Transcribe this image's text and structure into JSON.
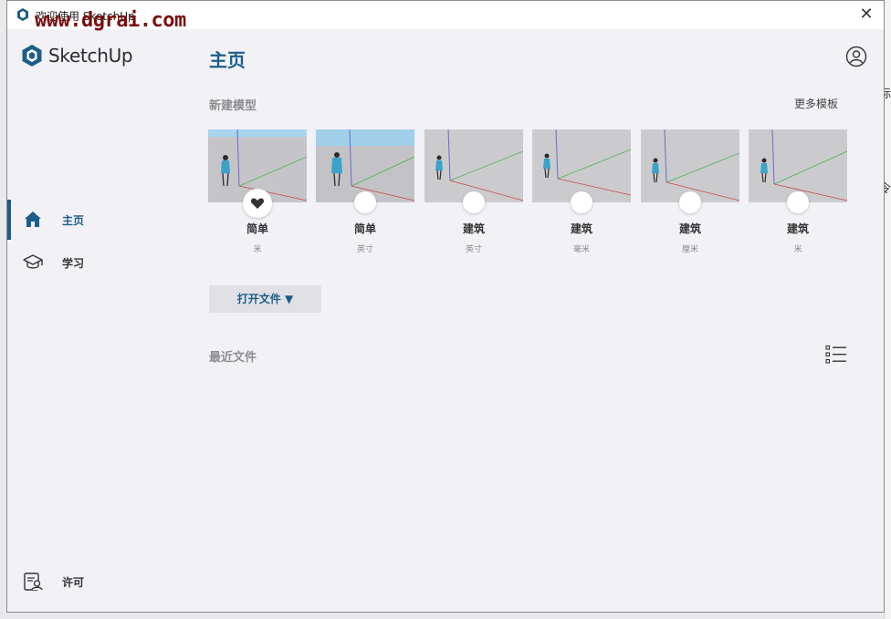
{
  "window": {
    "title": "欢迎使用 SketchUp",
    "watermark": "www.dgrai.com",
    "close_glyph": "✕"
  },
  "background": {
    "side_char_1": "标",
    "side_char_2": "令"
  },
  "brand": {
    "name": "SketchUp",
    "color": "#1c5e88"
  },
  "sidebar": {
    "items": [
      {
        "label": "主页",
        "icon": "home-icon",
        "active": true
      },
      {
        "label": "学习",
        "icon": "graduation-cap-icon",
        "active": false
      },
      {
        "label": "许可",
        "icon": "license-icon",
        "active": false
      }
    ]
  },
  "main": {
    "title": "主页",
    "new_model_label": "新建模型",
    "more_templates": "更多模板",
    "templates": [
      {
        "name": "简单",
        "unit": "米",
        "favorite": true
      },
      {
        "name": "简单",
        "unit": "英寸",
        "favorite": false
      },
      {
        "name": "建筑",
        "unit": "英寸",
        "favorite": false
      },
      {
        "name": "建筑",
        "unit": "毫米",
        "favorite": false
      },
      {
        "name": "建筑",
        "unit": "厘米",
        "favorite": false
      },
      {
        "name": "建筑",
        "unit": "米",
        "favorite": false
      }
    ],
    "open_file": "打开文件 ▼",
    "recent_files_label": "最近文件"
  }
}
